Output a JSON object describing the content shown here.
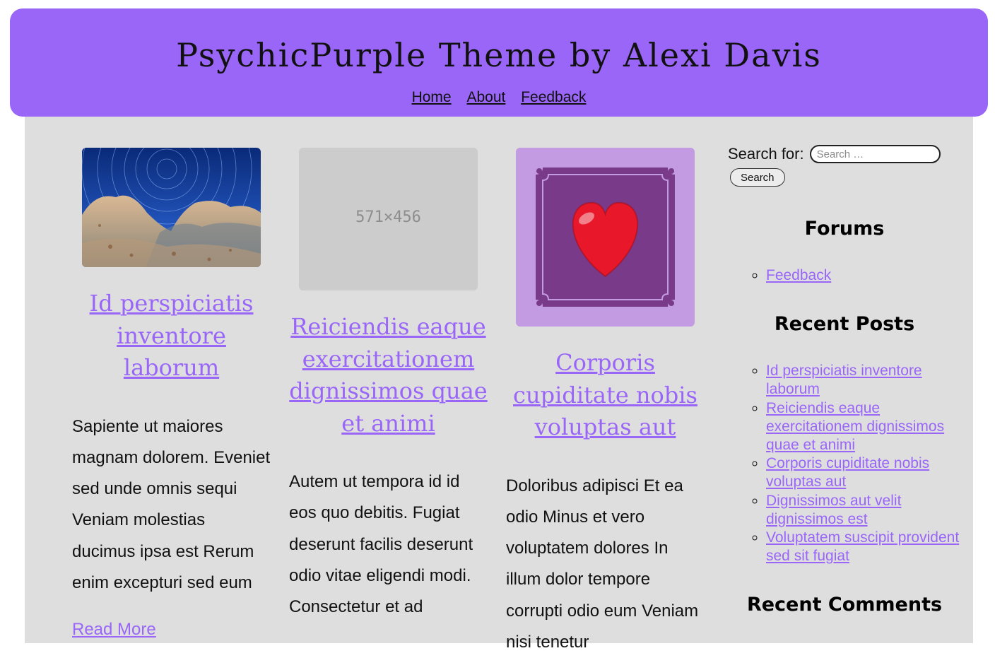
{
  "site": {
    "title": "PsychicPurple Theme by Alexi Davis",
    "nav": [
      "Home",
      "About",
      "Feedback"
    ]
  },
  "colors": {
    "accent": "#9966f8",
    "content_bg": "#dedede",
    "text": "#111111"
  },
  "posts": [
    {
      "thumb": "night-sky-rocks-photo",
      "title": "Id perspiciatis inventore laborum",
      "excerpt": "Sapiente ut maiores magnam dolorem. Eveniet sed unde omnis sequi Veniam molestias ducimus ipsa est Rerum enim excepturi sed eum",
      "read_more": "Read More"
    },
    {
      "thumb": "placeholder-image",
      "placeholder_text": "571×456",
      "title": "Reiciendis eaque exercitationem dignissimos quae et animi",
      "excerpt": "Autem ut tempora id id eos quo debitis. Fugiat deserunt facilis deserunt odio vitae eligendi modi. Consectetur et ad"
    },
    {
      "thumb": "heart-card-image",
      "title": "Corporis cupiditate nobis voluptas aut",
      "excerpt": "Doloribus adipisci Et ea odio Minus et vero voluptatem dolores In illum dolor tempore corrupti odio eum Veniam nisi tenetur"
    }
  ],
  "sidebar": {
    "search_label": "Search for:",
    "search_placeholder": "Search …",
    "search_button": "Search",
    "forums_title": "Forums",
    "forums": [
      "Feedback"
    ],
    "recent_posts_title": "Recent Posts",
    "recent_posts": [
      "Id perspiciatis inventore laborum",
      "Reiciendis eaque exercitationem dignissimos quae et animi",
      "Corporis cupiditate nobis voluptas aut",
      "Dignissimos aut velit dignissimos est",
      "Voluptatem suscipit provident sed sit fugiat"
    ],
    "recent_comments_title": "Recent Comments"
  }
}
